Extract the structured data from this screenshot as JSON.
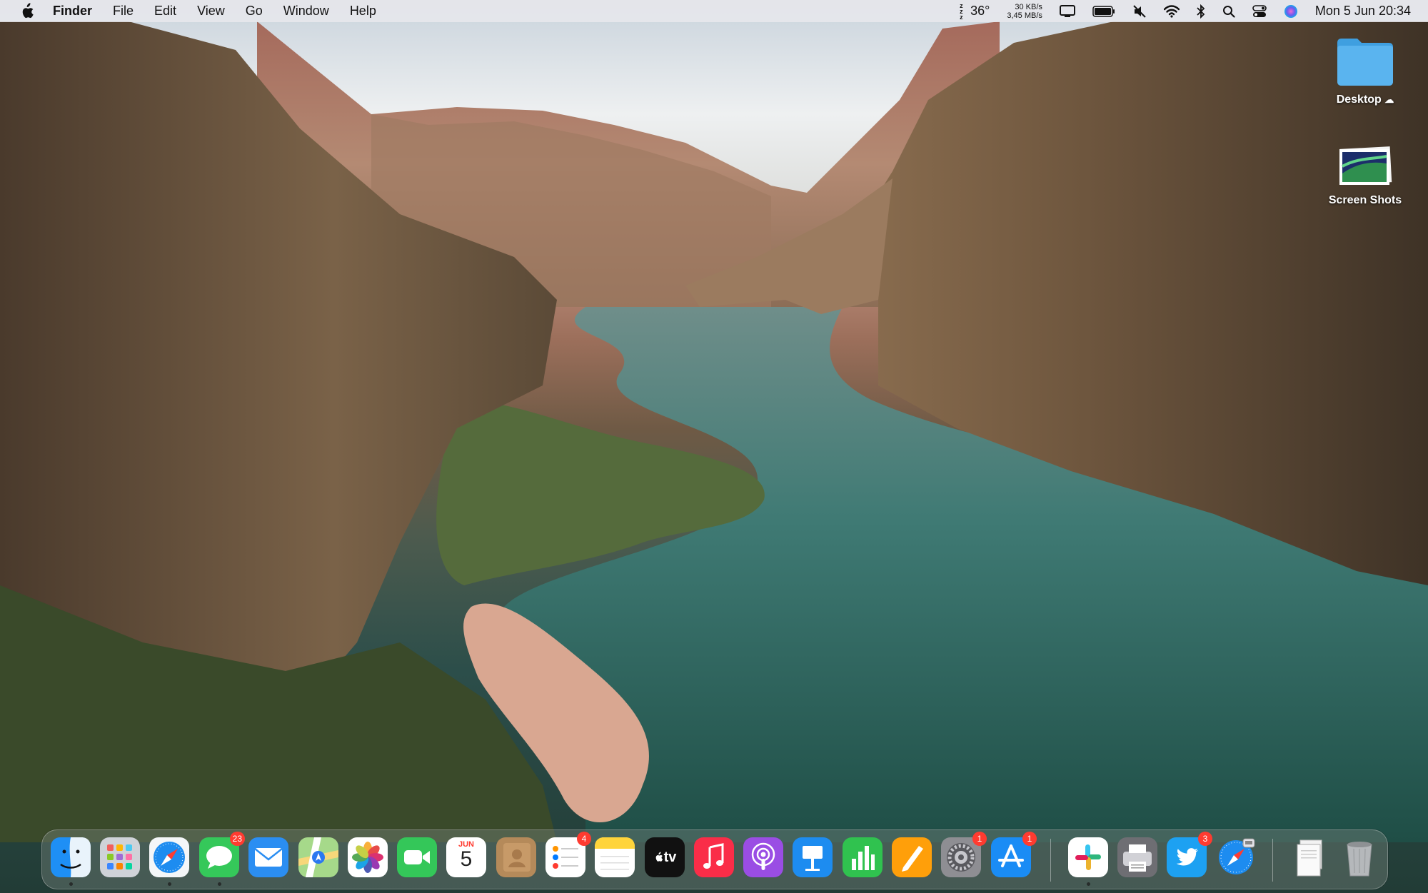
{
  "menubar": {
    "app_name": "Finder",
    "menus": [
      "File",
      "Edit",
      "View",
      "Go",
      "Window",
      "Help"
    ],
    "weather_temp": "36°",
    "net_up": "30 KB/s",
    "net_down": "3,45 MB/s",
    "datetime": "Mon 5 Jun  20:34"
  },
  "desktop": {
    "icons": [
      {
        "label": "Desktop",
        "icon": "folder-icon"
      },
      {
        "label": "Screen Shots",
        "icon": "image-thumbnail-icon"
      }
    ]
  },
  "dock": {
    "apps": [
      {
        "name": "Finder",
        "icon": "finder-icon",
        "running": true
      },
      {
        "name": "Launchpad",
        "icon": "launchpad-icon"
      },
      {
        "name": "Safari",
        "icon": "safari-icon",
        "running": true
      },
      {
        "name": "Messages",
        "icon": "messages-icon",
        "badge": "23",
        "running": true
      },
      {
        "name": "Mail",
        "icon": "mail-icon"
      },
      {
        "name": "Maps",
        "icon": "maps-icon"
      },
      {
        "name": "Photos",
        "icon": "photos-icon"
      },
      {
        "name": "FaceTime",
        "icon": "facetime-icon"
      },
      {
        "name": "Calendar",
        "icon": "calendar-icon",
        "month": "JUN",
        "day": "5"
      },
      {
        "name": "Contacts",
        "icon": "contacts-icon"
      },
      {
        "name": "Reminders",
        "icon": "reminders-icon",
        "badge": "4"
      },
      {
        "name": "Notes",
        "icon": "notes-icon"
      },
      {
        "name": "TV",
        "icon": "apple-tv-icon",
        "text": "tv"
      },
      {
        "name": "Music",
        "icon": "music-icon"
      },
      {
        "name": "Podcasts",
        "icon": "podcasts-icon"
      },
      {
        "name": "Keynote",
        "icon": "keynote-icon"
      },
      {
        "name": "Numbers",
        "icon": "numbers-icon"
      },
      {
        "name": "Pages",
        "icon": "pages-icon"
      },
      {
        "name": "System Settings",
        "icon": "settings-gear-icon",
        "badge": "1"
      },
      {
        "name": "App Store",
        "icon": "app-store-icon",
        "badge": "1"
      },
      {
        "name": "Slack",
        "icon": "slack-icon",
        "running": true
      },
      {
        "name": "Printer",
        "icon": "printer-icon"
      },
      {
        "name": "Twitter",
        "icon": "twitter-icon",
        "badge": "3"
      },
      {
        "name": "Safari Web App",
        "icon": "safari-webapp-icon"
      },
      {
        "name": "Documents",
        "icon": "documents-stack-icon"
      },
      {
        "name": "Trash",
        "icon": "trash-icon"
      }
    ]
  },
  "colors": {
    "badge": "#ff3b30",
    "folder": "#5ab4ef"
  }
}
